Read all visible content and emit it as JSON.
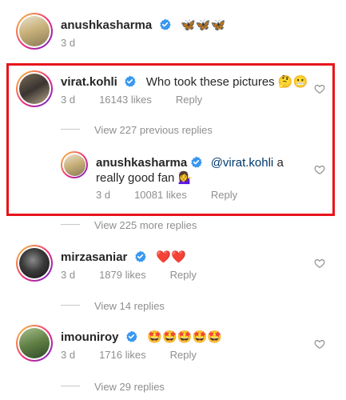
{
  "comments": [
    {
      "username": "anushkasharma",
      "text": "🦋🦋🦋",
      "time": "3 d"
    },
    {
      "username": "virat.kohli",
      "text": "Who took these pictures 🤔😬",
      "time": "3 d",
      "likes": "16143 likes",
      "reply_label": "Reply",
      "view_replies": "View 227 previous replies",
      "reply": {
        "username": "anushkasharma",
        "mention": "@virat.kohli",
        "text_after_mention": " a",
        "text_line2": "really good fan 💁‍♀️",
        "time": "3 d",
        "likes": "10081 likes",
        "reply_label": "Reply"
      },
      "more_replies": "View 225 more replies"
    },
    {
      "username": "mirzasaniar",
      "text": "❤️❤️",
      "time": "3 d",
      "likes": "1879 likes",
      "reply_label": "Reply",
      "view_replies": "View 14 replies"
    },
    {
      "username": "imouniroy",
      "text": "🤩🤩🤩🤩🤩",
      "time": "3 d",
      "likes": "1716 likes",
      "reply_label": "Reply",
      "view_replies": "View 29 replies"
    }
  ],
  "colors": {
    "highlight_border": "#e8141b",
    "verified": "#3897f0",
    "muted": "#8e8e8e",
    "mention": "#00376b"
  }
}
